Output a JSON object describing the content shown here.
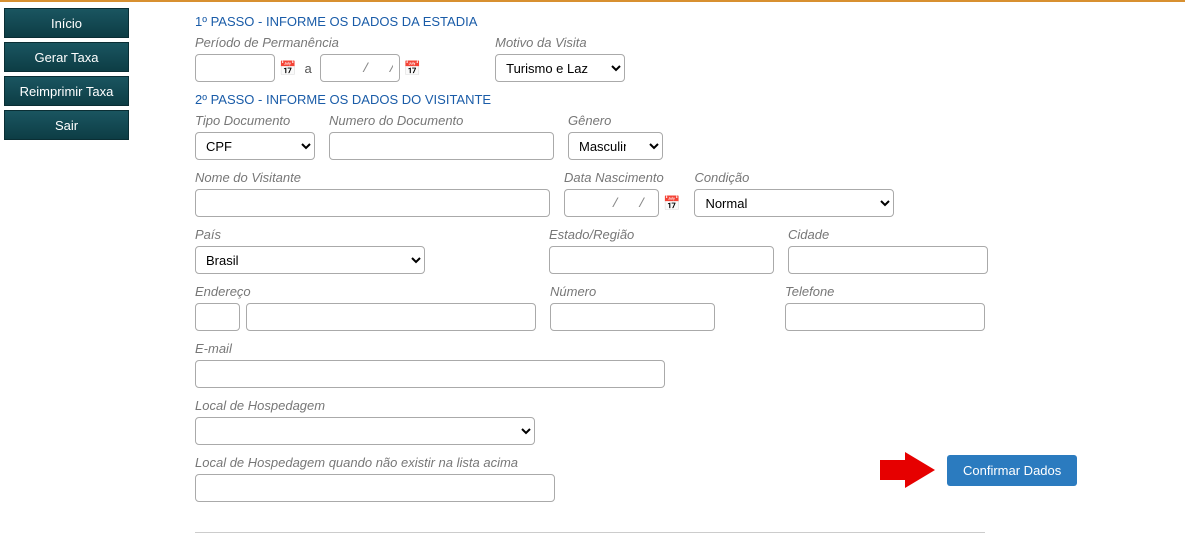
{
  "sidebar": {
    "items": [
      {
        "label": "Início"
      },
      {
        "label": "Gerar Taxa"
      },
      {
        "label": "Reimprimir Taxa"
      },
      {
        "label": "Sair"
      }
    ]
  },
  "step1": {
    "title": "1º PASSO - INFORME OS DADOS DA ESTADIA",
    "periodo_label": "Período de Permanência",
    "date_from": "  /  /",
    "a": "a",
    "date_to": "    /  /",
    "motivo_label": "Motivo da Visita",
    "motivo_value": "Turismo e Lazer"
  },
  "step2": {
    "title": "2º PASSO - INFORME OS DADOS DO VISITANTE",
    "tipo_doc_label": "Tipo Documento",
    "tipo_doc_value": "CPF",
    "num_doc_label": "Numero do Documento",
    "num_doc_value": "",
    "genero_label": "Gênero",
    "genero_value": "Masculino",
    "nome_label": "Nome do Visitante",
    "nome_value": "",
    "nasc_label": "Data Nascimento",
    "nasc_value": "    /  /",
    "cond_label": "Condição",
    "cond_value": "Normal",
    "pais_label": "País",
    "pais_value": "Brasil",
    "estado_label": "Estado/Região",
    "estado_value": "",
    "cidade_label": "Cidade",
    "cidade_value": "",
    "endereco_label": "Endereço",
    "endereco_value": "",
    "endereco_pre_value": "",
    "numero_label": "Número",
    "numero_value": "",
    "telefone_label": "Telefone",
    "telefone_value": "",
    "email_label": "E-mail",
    "email_value": "",
    "local_label": "Local de Hospedagem",
    "local_value": "",
    "local_alt_label": "Local de Hospedagem quando não existir na lista acima",
    "local_alt_value": ""
  },
  "confirm_label": "Confirmar Dados"
}
